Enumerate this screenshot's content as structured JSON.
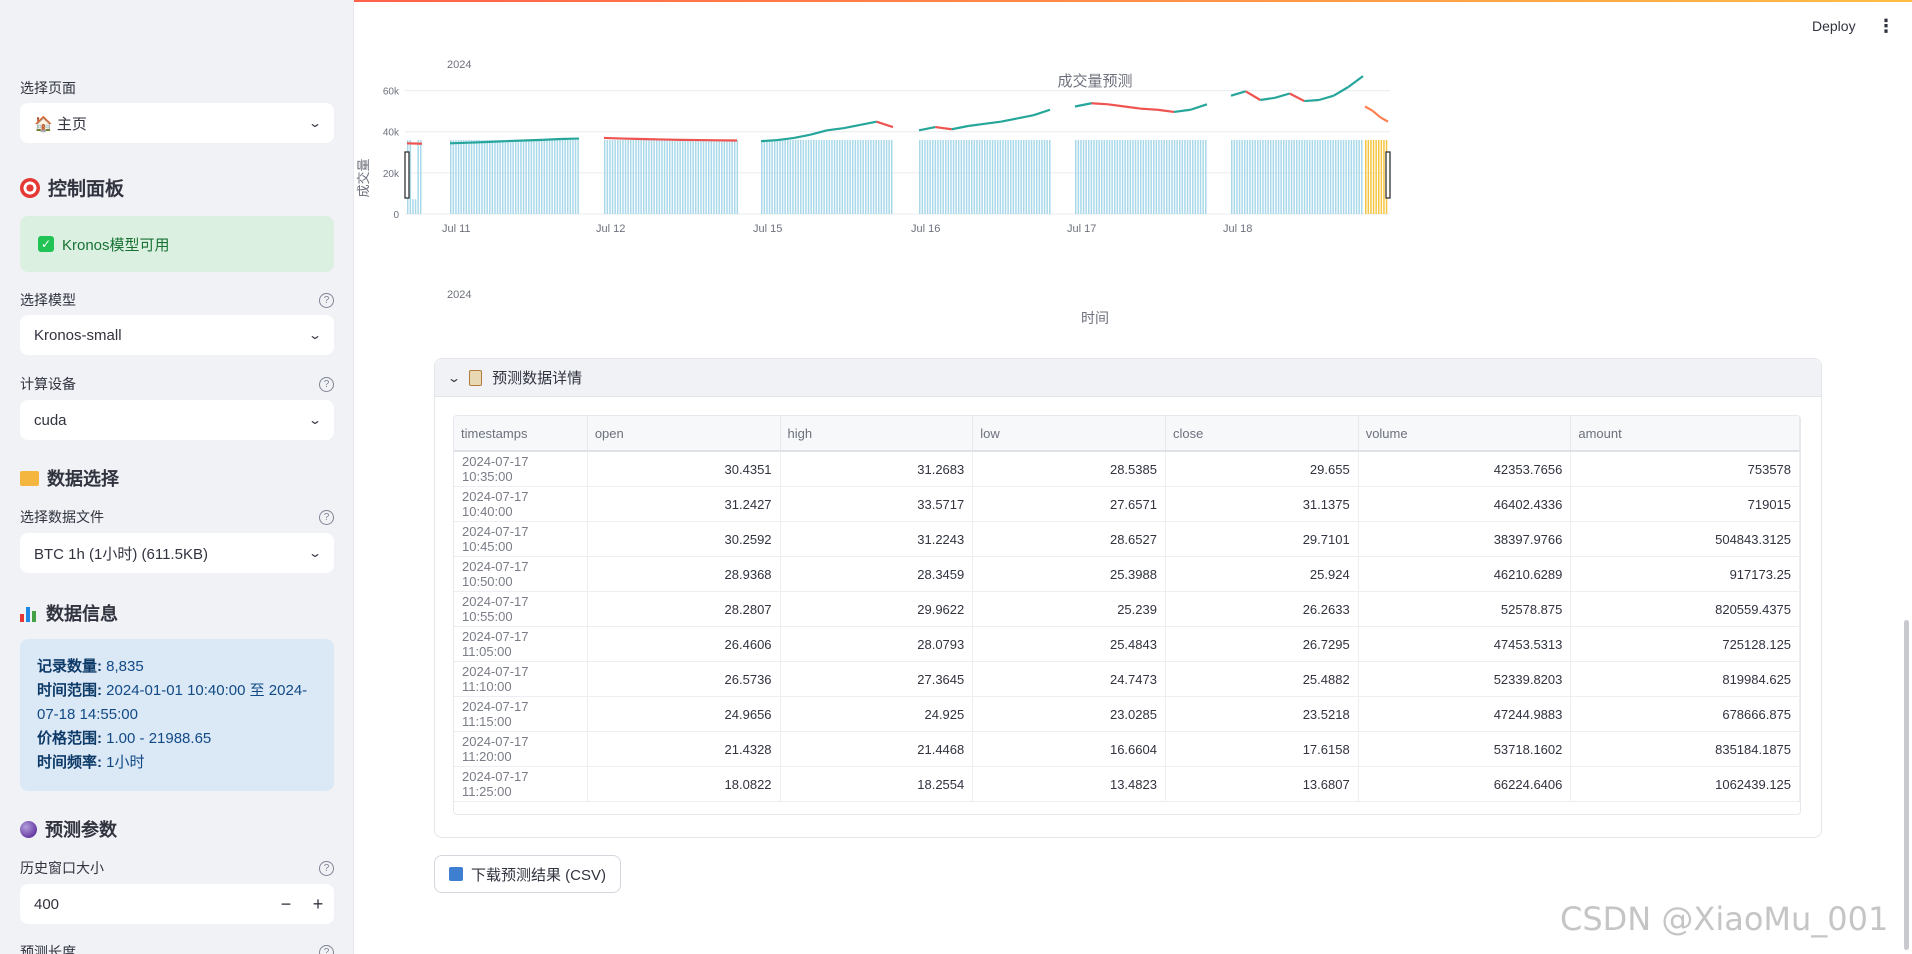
{
  "sidebar": {
    "page_select_label": "选择页面",
    "page_select_value": "🏠 主页",
    "control_panel_title": "控制面板",
    "model_status": "Kronos模型可用",
    "model_label": "选择模型",
    "model_value": "Kronos-small",
    "device_label": "计算设备",
    "device_value": "cuda",
    "data_select_title": "数据选择",
    "data_file_label": "选择数据文件",
    "data_file_value": "BTC 1h (1小时) (611.5KB)",
    "data_info_title": "数据信息",
    "data_info": {
      "records_key": "记录数量:",
      "records_val": " 8,835",
      "time_range_key": "时间范围:",
      "time_range_val": " 2024-01-01 10:40:00 至 2024-07-18 14:55:00",
      "price_range_key": "价格范围:",
      "price_range_val": " 1.00 - 21988.65",
      "freq_key": "时间频率:",
      "freq_val": " 1小时"
    },
    "params_title": "预测参数",
    "history_window_label": "历史窗口大小",
    "history_window_value": "400",
    "pred_len_label": "预测长度",
    "help_glyph": "?",
    "minus": "−",
    "plus": "+"
  },
  "header": {
    "deploy": "Deploy",
    "menu_glyph": "⋮"
  },
  "chart_data": {
    "type": "bar",
    "title": "成交量预测",
    "xlabel": "时间",
    "ylabel": "成交量",
    "year_label_top": "2024",
    "year_label_bottom": "2024",
    "y_ticks": [
      "0",
      "20k",
      "40k",
      "60k"
    ],
    "ylim": [
      0,
      70000
    ],
    "x_ticks": [
      "Jul 11",
      "Jul 12",
      "Jul 15",
      "Jul 16",
      "Jul 17",
      "Jul 18"
    ],
    "series": [
      {
        "name": "history",
        "color": "#a8d8ea",
        "segments": [
          {
            "start": "Jul 10",
            "values_level": 36000
          },
          {
            "start": "Jul 11",
            "values_level": 36000
          },
          {
            "start": "Jul 12",
            "values_level": 36000
          },
          {
            "start": "Jul 15",
            "values_level": 36000
          },
          {
            "start": "Jul 16",
            "values_level": 36000
          },
          {
            "start": "Jul 17",
            "values_level": 36000
          },
          {
            "start": "Jul 18",
            "values_level": 36000
          }
        ]
      },
      {
        "name": "prediction",
        "color": "#f5c542",
        "values_level": 36000
      }
    ],
    "price_line": [
      {
        "seg": 0,
        "values": [
          44000,
          43800
        ]
      },
      {
        "seg": 1,
        "values": [
          44000,
          44300,
          44600,
          45000,
          45300,
          45600,
          46000,
          46200
        ]
      },
      {
        "seg": 2,
        "values": [
          46500,
          46200,
          46000,
          45800,
          45600,
          45500,
          45400,
          45300
        ]
      },
      {
        "seg": 3,
        "values": [
          45000,
          45500,
          46500,
          48000,
          50000,
          51000,
          52500,
          54000,
          51500
        ]
      },
      {
        "seg": 4,
        "values": [
          50000,
          51500,
          50500,
          52000,
          53000,
          54000,
          55500,
          57000,
          59500
        ]
      },
      {
        "seg": 5,
        "values": [
          61000,
          62500,
          62000,
          61000,
          60000,
          59500,
          58500,
          59500,
          62000
        ]
      },
      {
        "seg": 6,
        "values": [
          66000,
          68000,
          64000,
          65000,
          67000,
          63500,
          64000,
          66000,
          70000,
          75000
        ]
      },
      {
        "seg": 7,
        "values": [
          61000,
          59000,
          56000,
          54000
        ]
      }
    ]
  },
  "details": {
    "title": "预测数据详情",
    "columns": [
      "timestamps",
      "open",
      "high",
      "low",
      "close",
      "volume",
      "amount"
    ],
    "rows": [
      [
        "2024-07-17 10:35:00",
        "30.4351",
        "31.2683",
        "28.5385",
        "29.655",
        "42353.7656",
        "753578"
      ],
      [
        "2024-07-17 10:40:00",
        "31.2427",
        "33.5717",
        "27.6571",
        "31.1375",
        "46402.4336",
        "719015"
      ],
      [
        "2024-07-17 10:45:00",
        "30.2592",
        "31.2243",
        "28.6527",
        "29.7101",
        "38397.9766",
        "504843.3125"
      ],
      [
        "2024-07-17 10:50:00",
        "28.9368",
        "28.3459",
        "25.3988",
        "25.924",
        "46210.6289",
        "917173.25"
      ],
      [
        "2024-07-17 10:55:00",
        "28.2807",
        "29.9622",
        "25.239",
        "26.2633",
        "52578.875",
        "820559.4375"
      ],
      [
        "2024-07-17 11:05:00",
        "26.4606",
        "28.0793",
        "25.4843",
        "26.7295",
        "47453.5313",
        "725128.125"
      ],
      [
        "2024-07-17 11:10:00",
        "26.5736",
        "27.3645",
        "24.7473",
        "25.4882",
        "52339.8203",
        "819984.625"
      ],
      [
        "2024-07-17 11:15:00",
        "24.9656",
        "24.925",
        "23.0285",
        "23.5218",
        "47244.9883",
        "678666.875"
      ],
      [
        "2024-07-17 11:20:00",
        "21.4328",
        "21.4468",
        "16.6604",
        "17.6158",
        "53718.1602",
        "835184.1875"
      ],
      [
        "2024-07-17 11:25:00",
        "18.0822",
        "18.2554",
        "13.4823",
        "13.6807",
        "66224.6406",
        "1062439.125"
      ]
    ]
  },
  "download_label": "下载预测结果 (CSV)",
  "watermark": "CSDN @XiaoMu_001"
}
